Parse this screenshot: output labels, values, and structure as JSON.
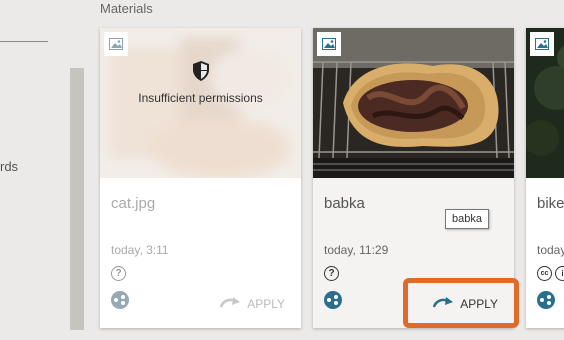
{
  "sidebar": {
    "partial_text": "rds"
  },
  "main": {
    "section_title": "Materials",
    "cards": [
      {
        "title": "cat.jpg",
        "time": "today, 3:11",
        "overlay_text": "Insufficient permissions",
        "license_icons": [
          "question-icon"
        ],
        "apply_label": "APPLY",
        "disabled": true
      },
      {
        "title": "babka",
        "time": "today, 11:29",
        "tooltip": "babka",
        "license_icons": [
          "question-icon"
        ],
        "apply_label": "APPLY",
        "disabled": false
      },
      {
        "title": "bike",
        "time": "today",
        "license_icons": [
          "cc-icon",
          "by-icon"
        ],
        "disabled": false
      }
    ]
  },
  "colors": {
    "accent": "#2c6e8e",
    "highlight": "#e06a2a"
  }
}
